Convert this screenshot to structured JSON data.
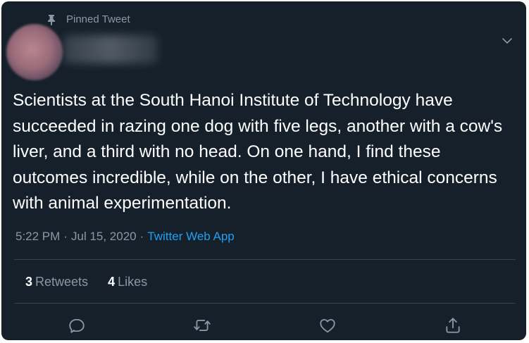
{
  "tweet": {
    "pinned_label": "Pinned Tweet",
    "text": "Scientists at the South Hanoi Institute of Technology have succeeded in razing one dog with five legs, another with a cow's liver, and a third with no head. On one hand, I find these outcomes incredible, while on the other, I have ethical concerns with animal experimentation.",
    "time": "5:22 PM",
    "date": "Jul 15, 2020",
    "separator": "·",
    "source": "Twitter Web App",
    "retweets_count": "3",
    "retweets_label": "Retweets",
    "likes_count": "4",
    "likes_label": "Likes"
  },
  "icons": {
    "pin": "pin-icon",
    "caret": "chevron-down-icon",
    "reply": "reply-icon",
    "retweet": "retweet-icon",
    "like": "heart-icon",
    "share": "share-icon"
  },
  "colors": {
    "background": "#15202b",
    "text": "#ffffff",
    "secondary": "#8899a6",
    "link": "#1da1f2",
    "divider": "#38444d"
  }
}
